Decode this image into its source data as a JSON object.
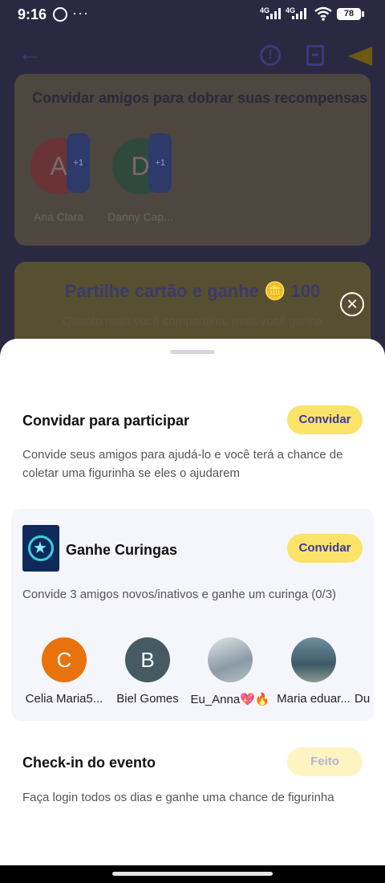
{
  "status_bar": {
    "time": "9:16",
    "dots": "···",
    "net1": "4G",
    "net2": "4G",
    "battery": "78"
  },
  "background": {
    "invite_title": "Convidar amigos para dobrar suas recompensas",
    "friends": [
      {
        "initial": "A",
        "badge": "+1",
        "name": "Ana Clara",
        "color": "#6a3336"
      },
      {
        "initial": "D",
        "badge": "+1",
        "name": "Danny Cap...",
        "color": "#2f4a3c"
      }
    ],
    "share_title": "Partilhe cartão e ganhe 🪙 100",
    "share_sub": "Quanto mais você compartilha, mais você ganha",
    "close": "✕"
  },
  "sheet": {
    "invite": {
      "title": "Convidar para participar",
      "button": "Convidar",
      "description": "Convide seus amigos para ajudá-lo e você terá a chance de coletar uma figurinha se eles o ajudarem"
    },
    "reward": {
      "title": "Ganhe Curingas",
      "button": "Convidar",
      "description": "Convide 3 amigos novos/inativos e ganhe um curinga (0/3)",
      "friends": [
        {
          "initial": "C",
          "name": "Celia Maria5...",
          "color": "#e8730c"
        },
        {
          "initial": "B",
          "name": "Biel Gomes",
          "color": "#465a64"
        },
        {
          "initial": "",
          "name": "Eu_Anna💖🔥",
          "color": "#b8c4cc"
        },
        {
          "initial": "",
          "name": "Maria eduar...",
          "color": "#5a7d8c"
        },
        {
          "initial": "",
          "name": "Du",
          "color": "#cccccc"
        }
      ]
    },
    "checkin": {
      "title": "Check-in do evento",
      "button": "Feito",
      "description": "Faça login todos os dias e ganhe uma chance de figurinha"
    }
  }
}
